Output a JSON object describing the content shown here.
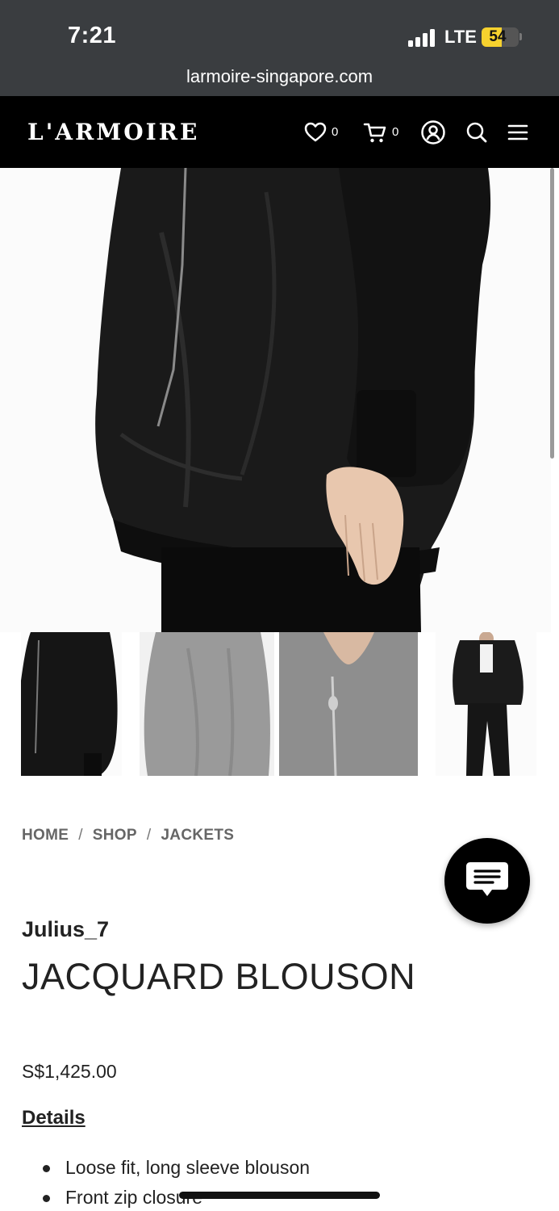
{
  "status_bar": {
    "time": "7:21",
    "network": "LTE",
    "battery": "54",
    "battery_level": 0.54,
    "url": "larmoire-singapore.com"
  },
  "header": {
    "logo": "L'ARMOIRE",
    "wishlist_count": "0",
    "cart_count": "0",
    "icons": [
      "heart-icon",
      "cart-icon",
      "account-icon",
      "search-icon",
      "menu-icon"
    ]
  },
  "breadcrumb": {
    "items": [
      "HOME",
      "SHOP",
      "JACKETS"
    ],
    "separator": "/"
  },
  "product": {
    "brand": "Julius_7",
    "title": "JACQUARD BLOUSON",
    "price": "S$1,425.00",
    "details_heading": "Details",
    "details": [
      "Loose fit, long sleeve blouson",
      "Front zip closure"
    ]
  },
  "colors": {
    "status_bg": "#3a3d40",
    "header_bg": "#000000",
    "battery": "#f7d22e",
    "breadcrumb": "#666666",
    "text": "#222222"
  }
}
